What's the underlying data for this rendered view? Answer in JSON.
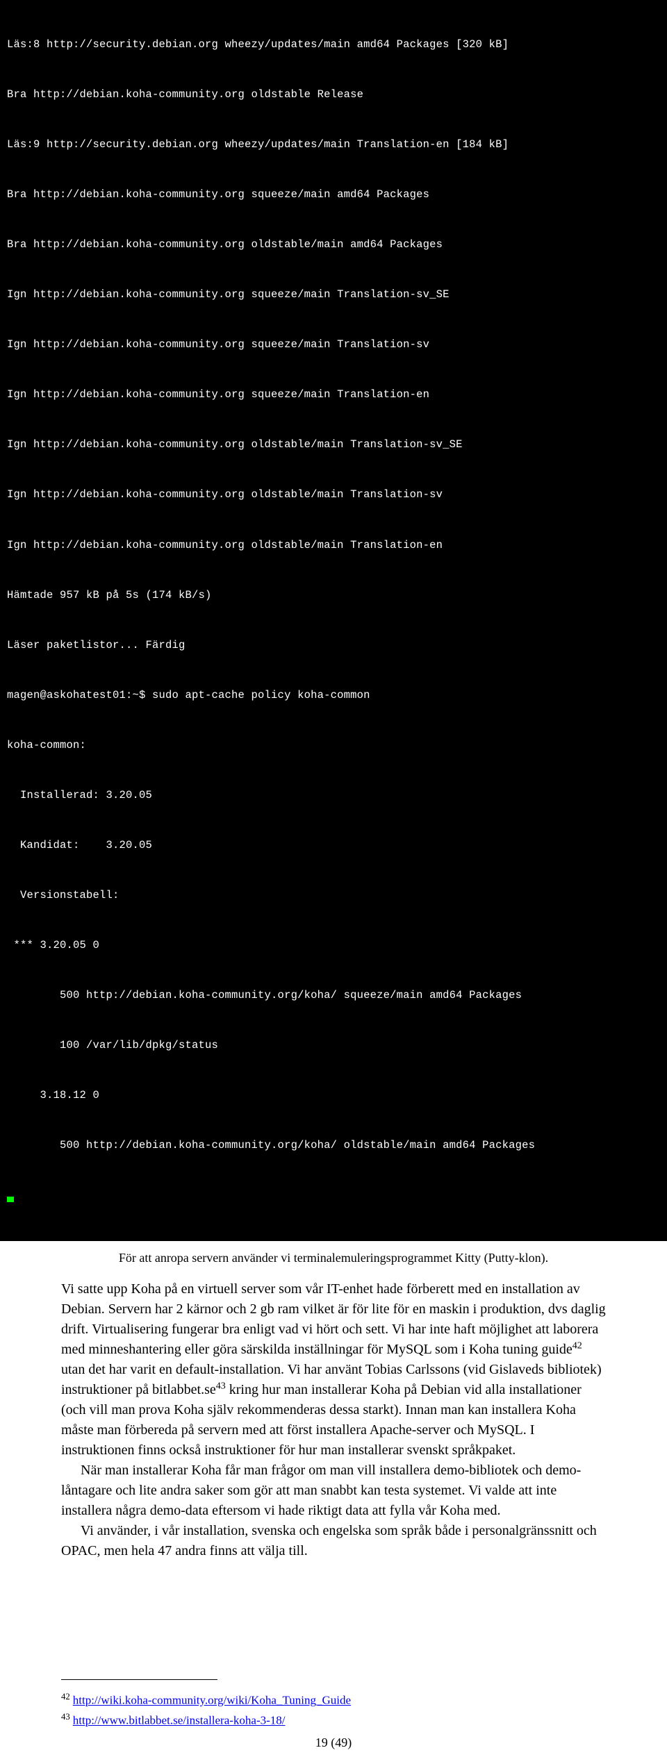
{
  "terminal": {
    "lines": [
      "Läs:8 http://security.debian.org wheezy/updates/main amd64 Packages [320 kB]",
      "Bra http://debian.koha-community.org oldstable Release",
      "Läs:9 http://security.debian.org wheezy/updates/main Translation-en [184 kB]",
      "Bra http://debian.koha-community.org squeeze/main amd64 Packages",
      "Bra http://debian.koha-community.org oldstable/main amd64 Packages",
      "Ign http://debian.koha-community.org squeeze/main Translation-sv_SE",
      "Ign http://debian.koha-community.org squeeze/main Translation-sv",
      "Ign http://debian.koha-community.org squeeze/main Translation-en",
      "Ign http://debian.koha-community.org oldstable/main Translation-sv_SE",
      "Ign http://debian.koha-community.org oldstable/main Translation-sv",
      "Ign http://debian.koha-community.org oldstable/main Translation-en",
      "Hämtade 957 kB på 5s (174 kB/s)",
      "Läser paketlistor... Färdig",
      "magen@askohatest01:~$ sudo apt-cache policy koha-common",
      "koha-common:",
      "  Installerad: 3.20.05",
      "  Kandidat:    3.20.05",
      "  Versionstabell:",
      " *** 3.20.05 0",
      "        500 http://debian.koha-community.org/koha/ squeeze/main amd64 Packages",
      "        100 /var/lib/dpkg/status",
      "     3.18.12 0",
      "        500 http://debian.koha-community.org/koha/ oldstable/main amd64 Packages"
    ]
  },
  "caption": "För att anropa servern använder vi terminalemuleringsprogrammet Kitty (Putty-klon).",
  "body": {
    "p1a": "Vi satte upp Koha på en virtuell server som vår IT-enhet hade förberett med en installation av Debian. Servern har 2 kärnor och 2 gb ram vilket är för lite för en maskin i produktion, dvs daglig drift. Virtualisering fungerar bra enligt vad vi hört och sett. Vi har inte haft möjlighet att laborera med minneshantering eller göra särskilda inställningar för MySQL som i Koha tuning guide",
    "p1b": " utan det har varit en default-installation. Vi har använt Tobias Carlssons (vid Gislaveds bibliotek) instruktioner på bitlabbet.se",
    "p1c": " kring hur man installerar Koha på Debian vid alla installationer (och vill man prova Koha själv rekommenderas dessa starkt). Innan man kan installera Koha måste man förbereda på servern med att först installera Apache-server och MySQL. I instruktionen finns också instruktioner för hur man installerar svenskt språkpaket.",
    "p2": "När man installerar Koha får man frågor om man vill installera demo-bibliotek och demo-låntagare och lite andra saker som gör att man snabbt kan testa systemet. Vi valde att inte installera några demo-data eftersom vi hade riktigt data att fylla vår Koha med.",
    "p3": "Vi använder, i vår installation, svenska och engelska som språk både i personalgränssnitt och OPAC, men hela 47 andra finns att välja till.",
    "sup42": "42",
    "sup43": "43"
  },
  "footnotes": {
    "n42": "42",
    "l42": "http://wiki.koha-community.org/wiki/Koha_Tuning_Guide",
    "n43": "43",
    "l43": "http://www.bitlabbet.se/installera-koha-3-18/"
  },
  "pagenum": "19 (49)"
}
